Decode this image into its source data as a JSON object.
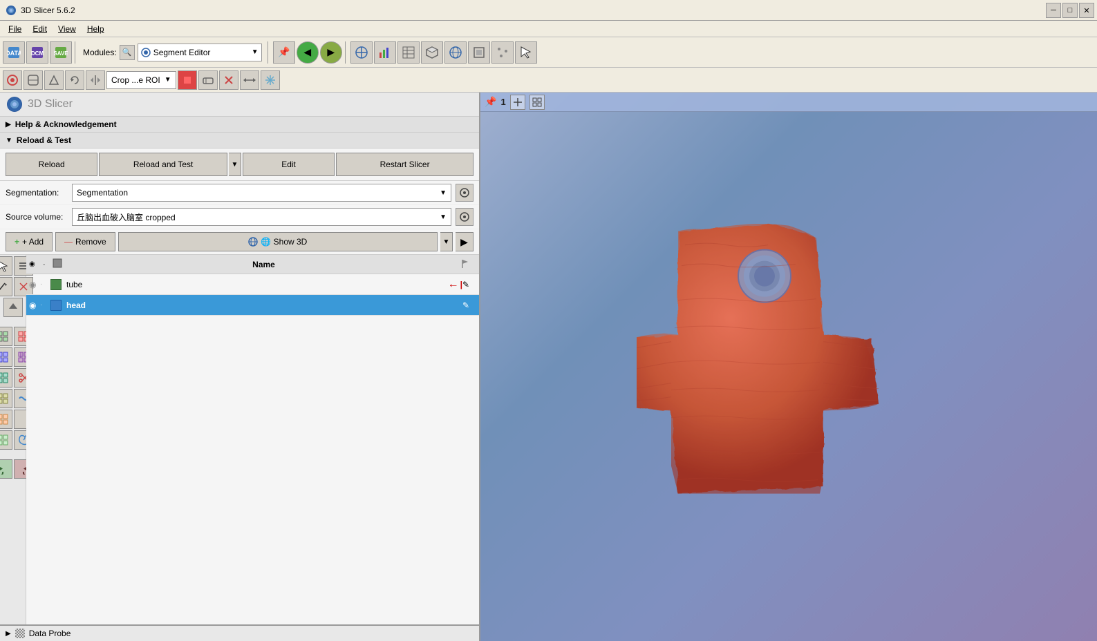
{
  "window": {
    "title": "3D Slicer 5.6.2",
    "icon": "slicer-icon"
  },
  "menu": {
    "items": [
      "File",
      "Edit",
      "View",
      "Help"
    ]
  },
  "toolbar": {
    "modules_label": "Modules:",
    "module_name": "Segment Editor",
    "nav_back": "◀",
    "nav_forward": "▶"
  },
  "panel_header": {
    "title": "3D Slicer"
  },
  "help_section": {
    "label": "Help & Acknowledgement",
    "collapsed": true
  },
  "reload_test": {
    "section_label": "Reload & Test",
    "reload_btn": "Reload",
    "reload_and_test_btn": "Reload and Test",
    "edit_btn": "Edit",
    "restart_btn": "Restart Slicer"
  },
  "segmentation": {
    "label": "Segmentation:",
    "value": "Segmentation",
    "source_label": "Source volume:",
    "source_value": "丘脑出血破入脑室 cropped"
  },
  "actions": {
    "add_btn": "+ Add",
    "remove_btn": "— Remove",
    "show3d_btn": "🌐 Show 3D"
  },
  "segments_table": {
    "col_name": "Name",
    "rows": [
      {
        "id": "tube",
        "name": "tube",
        "color": "#4a8a4a",
        "selected": false,
        "has_arrow": true
      },
      {
        "id": "head",
        "name": "head",
        "color": "#3a80c8",
        "selected": true,
        "has_arrow": false
      }
    ]
  },
  "view_controls": {
    "pin": "📌",
    "number": "1",
    "grid_icon": "⊞",
    "layout_icon": "⊟"
  },
  "data_probe": {
    "label": "Data Probe"
  },
  "colors": {
    "toolbar_bg": "#f0ece0",
    "panel_bg": "#f5f5f5",
    "selected_row": "#3a99d8",
    "shape_color": "#c8614a",
    "view_bg_top": "#a0b0d0",
    "view_bg_bottom": "#8090c0"
  }
}
